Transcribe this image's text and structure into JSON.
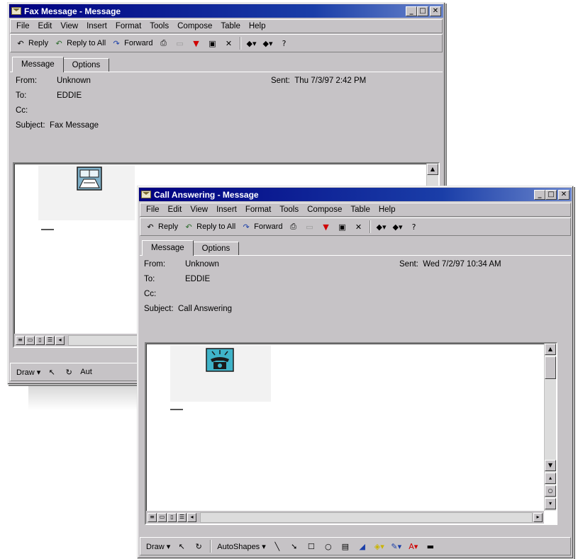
{
  "windows": {
    "fax": {
      "title": "Fax Message - Message",
      "menu": [
        "File",
        "Edit",
        "View",
        "Insert",
        "Format",
        "Tools",
        "Compose",
        "Table",
        "Help"
      ],
      "toolbar": {
        "reply": "Reply",
        "reply_all": "Reply to All",
        "forward": "Forward"
      },
      "tabs": [
        "Message",
        "Options"
      ],
      "from_label": "From:",
      "from_value": "Unknown",
      "to_label": "To:",
      "to_value": "EDDIE",
      "cc_label": "Cc:",
      "subject_label": "Subject:",
      "subject_value": "Fax Message",
      "sent_label": "Sent:",
      "sent_value": "Thu 7/3/97 2:42 PM",
      "drawbar": {
        "draw": "Draw ▾",
        "autoshapes": "Aut"
      },
      "doc_icon": "fax-document-icon"
    },
    "call": {
      "title": "Call Answering - Message",
      "menu": [
        "File",
        "Edit",
        "View",
        "Insert",
        "Format",
        "Tools",
        "Compose",
        "Table",
        "Help"
      ],
      "toolbar": {
        "reply": "Reply",
        "reply_all": "Reply to All",
        "forward": "Forward"
      },
      "tabs": [
        "Message",
        "Options"
      ],
      "from_label": "From:",
      "from_value": "Unknown",
      "to_label": "To:",
      "to_value": "EDDIE",
      "cc_label": "Cc:",
      "subject_label": "Subject:",
      "subject_value": "Call Answering",
      "sent_label": "Sent:",
      "sent_value": "Wed 7/2/97 10:34 AM",
      "drawbar": {
        "draw": "Draw ▾",
        "autoshapes": "AutoShapes ▾"
      },
      "doc_icon": "ringing-telephone-icon"
    }
  },
  "colors": {
    "titlebar": "#000080",
    "chrome": "#c6c3c6",
    "font_color_red": "#d00000"
  }
}
